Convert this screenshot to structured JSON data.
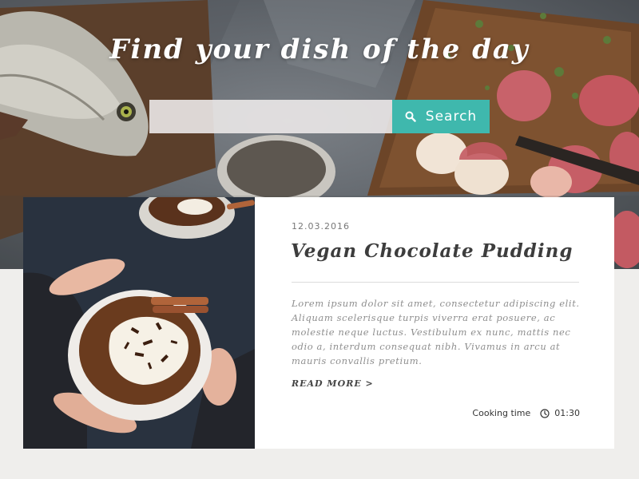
{
  "hero": {
    "title": "Find your dish of the day",
    "search_placeholder": "",
    "search_button_label": "Search",
    "accent_color": "#3fb8ad"
  },
  "card": {
    "date": "12.03.2016",
    "title": "Vegan Chocolate Pudding",
    "description": "Lorem ipsum dolor sit amet, consectetur adipiscing elit. Aliquam scelerisque turpis viverra erat posuere, ac molestie neque luctus. Vestibulum ex nunc, mattis nec odio a, interdum consequat nibh. Vivamus in arcu at mauris convallis pretium.",
    "read_more": "READ MORE >",
    "cooking_label": "Cooking time",
    "cooking_time": "01:30"
  },
  "icons": {
    "search": "search-icon",
    "clock": "clock-icon"
  }
}
